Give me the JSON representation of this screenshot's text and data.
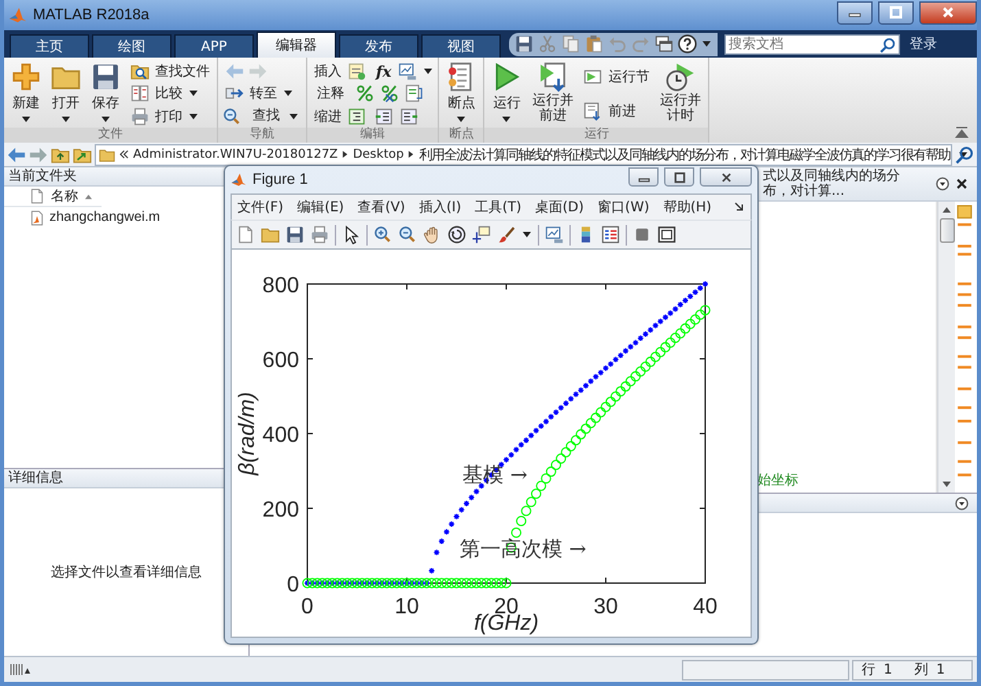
{
  "window": {
    "title": "MATLAB R2018a"
  },
  "tabs": [
    {
      "label": "主页",
      "selected": false
    },
    {
      "label": "绘图",
      "selected": false
    },
    {
      "label": "APP",
      "selected": false
    },
    {
      "label": "编辑器",
      "selected": true
    },
    {
      "label": "发布",
      "selected": false
    },
    {
      "label": "视图",
      "selected": false
    }
  ],
  "search": {
    "placeholder": "搜索文档"
  },
  "login": "登录",
  "ribbon": {
    "file": {
      "label": "文件",
      "new": "新建",
      "open": "打开",
      "save": "保存",
      "find_files": "查找文件",
      "compare": "比较",
      "print": "打印"
    },
    "navigate": {
      "label": "导航",
      "go_to": "转至",
      "find": "查找"
    },
    "edit": {
      "label": "编辑",
      "insert": "插入",
      "function": "fx",
      "comment": "注释",
      "indent": "缩进"
    },
    "breakpoints": {
      "label": "断点",
      "button": "断点"
    },
    "run": {
      "label": "运行",
      "run": "运行",
      "run_advance": "运行并前进",
      "run_section": "运行节",
      "advance": "前进",
      "run_time": "运行并计时"
    }
  },
  "address_bar": {
    "segments": [
      "Administrator.WIN7U-20180127Z",
      "Desktop",
      "利用全波法计算同轴线的特征模式以及同轴线内的场分布，对计算电磁学全波仿真的学习很有帮助"
    ]
  },
  "current_folder": {
    "title": "当前文件夹",
    "column": "名称",
    "files": [
      "zhangchangwei.m"
    ]
  },
  "details": {
    "title": "详细信息",
    "message": "选择文件以查看详细信息"
  },
  "editor": {
    "title": "式以及同轴线内的场分布，对计算...",
    "code_line": "始坐标"
  },
  "status_bar": {
    "row_label": "行",
    "row": "1",
    "col_label": "列",
    "col": "1"
  },
  "figure": {
    "title": "Figure 1",
    "menu": [
      "文件(F)",
      "编辑(E)",
      "查看(V)",
      "插入(I)",
      "工具(T)",
      "桌面(D)",
      "窗口(W)",
      "帮助(H)"
    ],
    "chart_data": {
      "type": "scatter",
      "xlabel": "f(GHz)",
      "ylabel": "β(rad/m)",
      "x": [
        0,
        0.5,
        1,
        1.5,
        2,
        2.5,
        3,
        3.5,
        4,
        4.5,
        5,
        5.5,
        6,
        6.5,
        7,
        7.5,
        8,
        8.5,
        9,
        9.5,
        10,
        10.5,
        11,
        11.5,
        12,
        12.5,
        13,
        13.5,
        14,
        14.5,
        15,
        15.5,
        16,
        16.5,
        17,
        17.5,
        18,
        18.5,
        19,
        19.5,
        20,
        20.5,
        21,
        21.5,
        22,
        22.5,
        23,
        23.5,
        24,
        24.5,
        25,
        25.5,
        26,
        26.5,
        27,
        27.5,
        28,
        28.5,
        29,
        29.5,
        30,
        30.5,
        31,
        31.5,
        32,
        32.5,
        33,
        33.5,
        34,
        34.5,
        35,
        35.5,
        36,
        36.5,
        37,
        37.5,
        38,
        38.5,
        39,
        39.5,
        40
      ],
      "series": [
        {
          "color": "#0000ff",
          "values": [
            0,
            0,
            0,
            0,
            0,
            0,
            0,
            0,
            0,
            0,
            0,
            0,
            0,
            0,
            0,
            0,
            0,
            0,
            0,
            0,
            0,
            0,
            0,
            0,
            0,
            33,
            82,
            112,
            137,
            158,
            178,
            196,
            213,
            229,
            245,
            260,
            275,
            289,
            303,
            317,
            330,
            343,
            357,
            370,
            382,
            395,
            408,
            420,
            432,
            445,
            457,
            469,
            481,
            493,
            505,
            516,
            528,
            540,
            552,
            563,
            575,
            586,
            598,
            609,
            621,
            632,
            643,
            655,
            666,
            677,
            689,
            700,
            711,
            722,
            733,
            745,
            756,
            767,
            778,
            789,
            800
          ]
        },
        {
          "color": "#00ff00",
          "values": [
            0,
            0,
            0,
            0,
            0,
            0,
            0,
            0,
            0,
            0,
            0,
            0,
            0,
            0,
            0,
            0,
            0,
            0,
            0,
            0,
            0,
            0,
            0,
            0,
            0,
            0,
            0,
            0,
            0,
            0,
            0,
            0,
            0,
            0,
            0,
            0,
            0,
            0,
            0,
            0,
            0,
            95,
            135,
            166,
            193,
            217,
            239,
            260,
            280,
            298,
            316,
            333,
            350,
            366,
            382,
            398,
            413,
            428,
            442,
            457,
            471,
            485,
            499,
            513,
            526,
            540,
            553,
            566,
            579,
            592,
            605,
            618,
            631,
            643,
            656,
            668,
            681,
            693,
            705,
            718,
            730
          ]
        }
      ],
      "xlim": [
        0,
        40
      ],
      "ylim": [
        0,
        800
      ],
      "xticks": [
        0,
        10,
        20,
        30,
        40
      ],
      "yticks": [
        0,
        200,
        400,
        600,
        800
      ],
      "annotations": [
        "基模 →",
        "第一高次模 →"
      ]
    }
  }
}
